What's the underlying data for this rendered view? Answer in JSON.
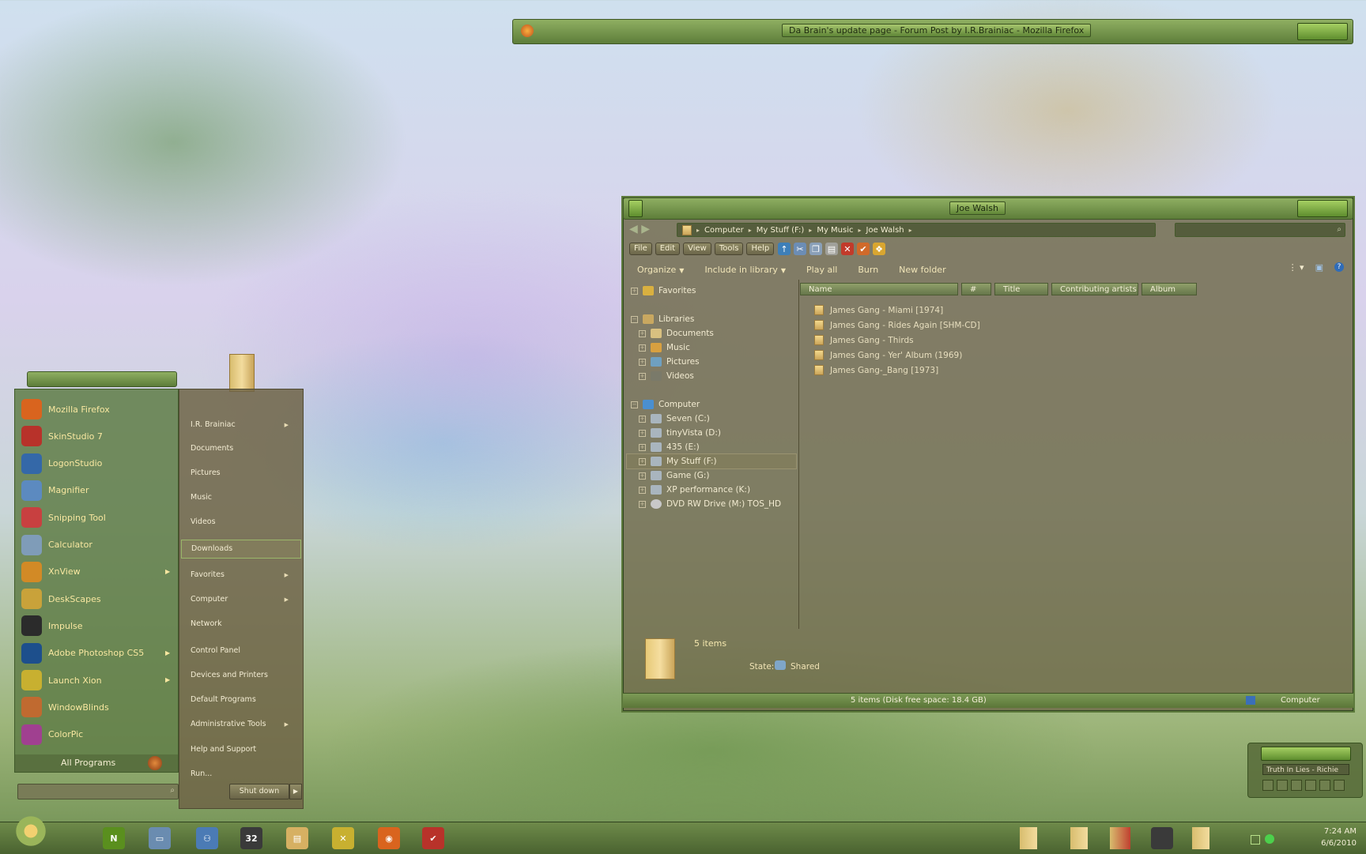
{
  "firefox": {
    "title": "Da Brain's update page - Forum Post by I.R.Brainiac - Mozilla Firefox"
  },
  "explorer": {
    "title": "Joe Walsh",
    "breadcrumb": [
      "Computer",
      "My Stuff (F:)",
      "My Music",
      "Joe Walsh"
    ],
    "menu": [
      "File",
      "Edit",
      "View",
      "Tools",
      "Help"
    ],
    "commands": [
      "Organize",
      "Include in library",
      "Play all",
      "Burn",
      "New folder"
    ],
    "nav": {
      "favorites": "Favorites",
      "libraries": "Libraries",
      "library_items": [
        "Documents",
        "Music",
        "Pictures",
        "Videos"
      ],
      "computer": "Computer",
      "drives": [
        "Seven (C:)",
        "tinyVista (D:)",
        "435 (E:)",
        "My Stuff (F:)",
        "Game (G:)",
        "XP performance (K:)",
        "DVD RW Drive (M:) TOS_HD"
      ]
    },
    "columns": [
      "Name",
      "#",
      "Title",
      "Contributing artists",
      "Album"
    ],
    "files": [
      "James Gang - Miami [1974]",
      "James Gang - Rides Again [SHM-CD]",
      "James Gang - Thirds",
      "James Gang - Yer' Album (1969)",
      "James Gang-_Bang [1973]"
    ],
    "details": {
      "count": "5 items",
      "state_label": "State:",
      "state_value": "Shared"
    },
    "status": {
      "text": "5 items (Disk free space: 18.4 GB)",
      "location": "Computer"
    }
  },
  "start_menu": {
    "programs": [
      {
        "label": "Mozilla Firefox",
        "icon": "firefox-icon",
        "color": "#d9641e",
        "arrow": false
      },
      {
        "label": "SkinStudio 7",
        "icon": "skinstudio-icon",
        "color": "#b8322a",
        "arrow": false
      },
      {
        "label": "LogonStudio",
        "icon": "logonstudio-icon",
        "color": "#3468a8",
        "arrow": false
      },
      {
        "label": "Magnifier",
        "icon": "magnifier-icon",
        "color": "#5c8ac0",
        "arrow": false
      },
      {
        "label": "Snipping Tool",
        "icon": "scissors-icon",
        "color": "#c84040",
        "arrow": false
      },
      {
        "label": "Calculator",
        "icon": "calculator-icon",
        "color": "#7f9cb8",
        "arrow": false
      },
      {
        "label": "XnView",
        "icon": "xnview-icon",
        "color": "#d28a26",
        "arrow": true
      },
      {
        "label": "DeskScapes",
        "icon": "deskscapes-icon",
        "color": "#c9a23a",
        "arrow": false
      },
      {
        "label": "Impulse",
        "icon": "impulse-icon",
        "color": "#2b2b2b",
        "arrow": false
      },
      {
        "label": "Adobe Photoshop CS5",
        "icon": "photoshop-icon",
        "color": "#1d4f8c",
        "arrow": true
      },
      {
        "label": "Launch Xion",
        "icon": "xion-icon",
        "color": "#c8b030",
        "arrow": true
      },
      {
        "label": "WindowBlinds",
        "icon": "windowblinds-icon",
        "color": "#c06a30",
        "arrow": false
      },
      {
        "label": "ColorPic",
        "icon": "colorpic-icon",
        "color": "#a04090",
        "arrow": false
      }
    ],
    "all_programs": "All Programs",
    "right_links": [
      {
        "label": "I.R. Brainiac",
        "arrow": true
      },
      {
        "label": "Documents",
        "arrow": false
      },
      {
        "label": "Pictures",
        "arrow": false
      },
      {
        "label": "Music",
        "arrow": false
      },
      {
        "label": "Videos",
        "arrow": false
      },
      {
        "label": "Downloads",
        "arrow": false
      },
      {
        "label": "Favorites",
        "arrow": true
      },
      {
        "label": "Computer",
        "arrow": true
      },
      {
        "label": "Network",
        "arrow": false
      },
      {
        "label": "Control Panel",
        "arrow": false
      },
      {
        "label": "Devices and Printers",
        "arrow": false
      },
      {
        "label": "Default Programs",
        "arrow": false
      },
      {
        "label": "Administrative Tools",
        "arrow": true
      },
      {
        "label": "Help and Support",
        "arrow": false
      },
      {
        "label": "Run...",
        "arrow": false
      }
    ],
    "shutdown": "Shut down"
  },
  "media": {
    "track": "Truth In Lies - Richie"
  },
  "taskbar": {
    "apps": [
      {
        "icon": "nvidia-icon",
        "color": "#5a8f1e",
        "glyph": "N"
      },
      {
        "icon": "computer-icon",
        "color": "#6a8cb0",
        "glyph": "▭"
      },
      {
        "icon": "network-icon",
        "color": "#4b7bb5",
        "glyph": "⚇"
      },
      {
        "icon": "calendar-icon",
        "color": "#3a3a3a",
        "glyph": "32"
      },
      {
        "icon": "explorer-icon",
        "color": "#d6b062",
        "glyph": "▤"
      },
      {
        "icon": "xion-icon",
        "color": "#c8b030",
        "glyph": "✕"
      },
      {
        "icon": "firefox-icon",
        "color": "#d9641e",
        "glyph": "◉"
      },
      {
        "icon": "skinstudio-icon",
        "color": "#b8322a",
        "glyph": "✔"
      }
    ],
    "time": "7:24 AM",
    "date": "6/6/2010"
  }
}
